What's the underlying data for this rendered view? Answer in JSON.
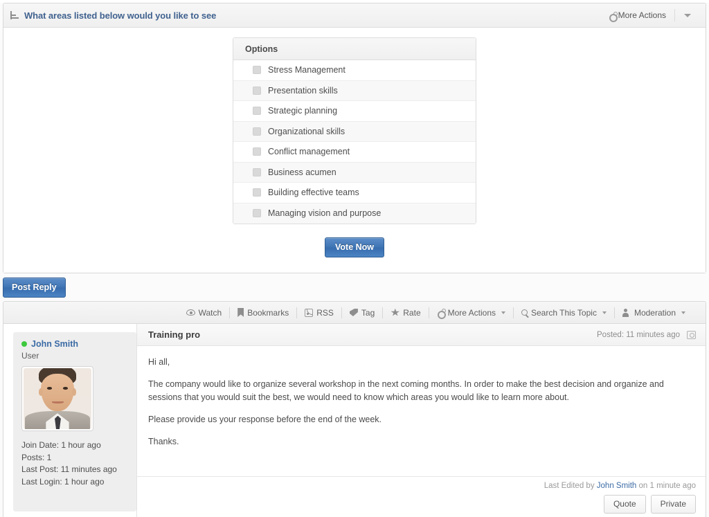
{
  "poll": {
    "icon": "poll-bars-icon",
    "question": "What areas listed below would you like to see",
    "more_actions_label": "More Actions",
    "options_header": "Options",
    "options": [
      "Stress Management",
      "Presentation skills",
      "Strategic planning",
      "Organizational skills",
      "Conflict management",
      "Business acumen",
      "Building effective teams",
      "Managing vision and purpose"
    ],
    "vote_button": "Vote Now"
  },
  "reply": {
    "post_reply_label": "Post Reply"
  },
  "toolbar": {
    "items": [
      {
        "label": "Watch",
        "icon": "eye-icon",
        "caret": false
      },
      {
        "label": "Bookmarks",
        "icon": "bookmark-icon",
        "caret": false
      },
      {
        "label": "RSS",
        "icon": "rss-icon",
        "caret": false
      },
      {
        "label": "Tag",
        "icon": "tag-icon",
        "caret": false
      },
      {
        "label": "Rate",
        "icon": "star-icon",
        "caret": false
      },
      {
        "label": "More Actions",
        "icon": "gear-icon",
        "caret": true
      },
      {
        "label": "Search This Topic",
        "icon": "search-icon",
        "caret": true
      },
      {
        "label": "Moderation",
        "icon": "moderation-user-icon",
        "caret": true
      }
    ]
  },
  "post": {
    "author": {
      "name": "John Smith",
      "role": "User",
      "status": "online",
      "status_color": "#3ec93e",
      "avatar": "user-photo-avatar",
      "stats": [
        "Join Date: 1 hour ago",
        "Posts: 1",
        "Last Post: 11 minutes ago",
        "Last Login: 1 hour ago"
      ]
    },
    "title": "Training pro",
    "posted": "Posted: 11 minutes ago",
    "permalink_icon": "screen-icon",
    "paragraphs": [
      "Hi all,",
      "The company would like to organize several workshop in the next coming months. In order to make the best decision and organize and sessions that you would suit the best, we would need to know which areas you would like to learn more about.",
      "Please provide us your response before the end of the week.",
      "Thanks."
    ],
    "edited_prefix": "Last Edited by",
    "edited_author": "John Smith",
    "edited_suffix": "on 1 minute ago",
    "quote_label": "Quote",
    "private_label": "Private"
  },
  "colors": {
    "link": "#3b6ba5",
    "poll_title": "#41628f",
    "primary_button": "#3f74b4",
    "online": "#3ec93e"
  }
}
